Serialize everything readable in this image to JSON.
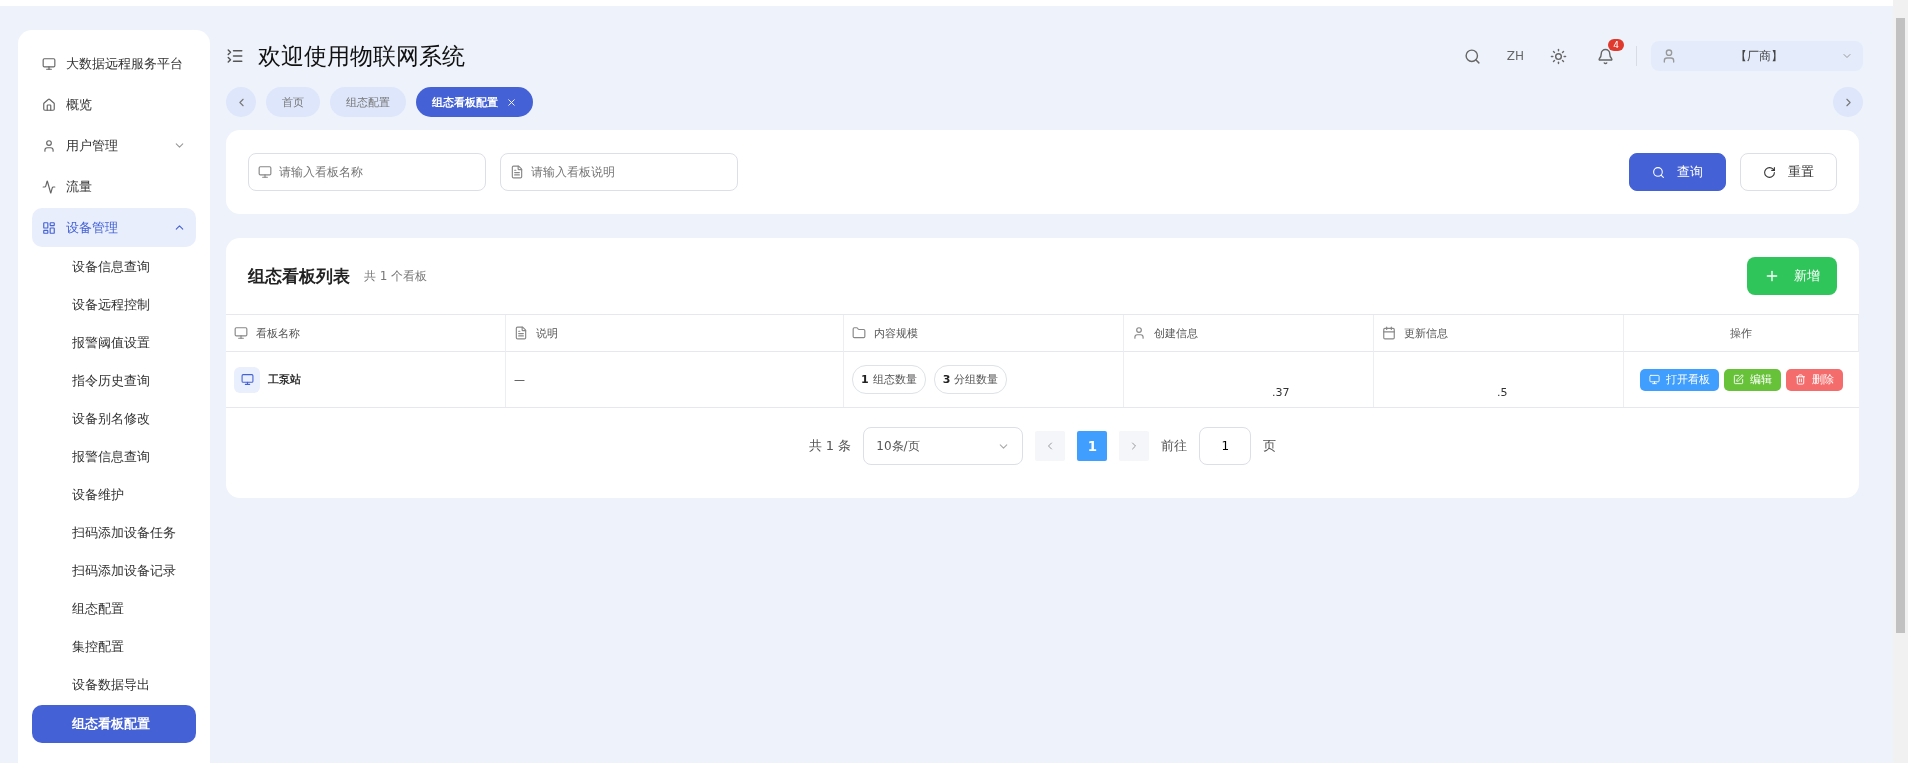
{
  "sidebar": {
    "items": [
      {
        "label": "大数据远程服务平台",
        "selected": false
      },
      {
        "label": "概览",
        "selected": false
      },
      {
        "label": "用户管理",
        "selected": false,
        "expanded": false
      },
      {
        "label": "流量",
        "selected": false
      },
      {
        "label": "设备管理",
        "selected": true,
        "expanded": true,
        "children": [
          {
            "label": "设备信息查询",
            "selected": false
          },
          {
            "label": "设备远程控制",
            "selected": false
          },
          {
            "label": "报警阈值设置",
            "selected": false
          },
          {
            "label": "指令历史查询",
            "selected": false
          },
          {
            "label": "设备别名修改",
            "selected": false
          },
          {
            "label": "报警信息查询",
            "selected": false
          },
          {
            "label": "设备维护",
            "selected": false
          },
          {
            "label": "扫码添加设备任务",
            "selected": false
          },
          {
            "label": "扫码添加设备记录",
            "selected": false
          },
          {
            "label": "组态配置",
            "selected": false
          },
          {
            "label": "集控配置",
            "selected": false
          },
          {
            "label": "设备数据导出",
            "selected": false
          },
          {
            "label": "组态看板配置",
            "selected": true
          }
        ]
      }
    ]
  },
  "header": {
    "title": "欢迎使用物联网系统",
    "language": "ZH",
    "notification_count": "4",
    "user": "【厂商】"
  },
  "tabs": [
    {
      "label": "首页",
      "selected": false
    },
    {
      "label": "组态配置",
      "selected": false
    },
    {
      "label": "组态看板配置",
      "selected": true
    }
  ],
  "search": {
    "fields": [
      {
        "placeholder": "请输入看板名称"
      },
      {
        "placeholder": "请输入看板说明"
      }
    ],
    "buttons": [
      {
        "label": "查询",
        "kind": "primary"
      },
      {
        "label": "重置",
        "kind": "default"
      }
    ]
  },
  "list": {
    "title": "组态看板列表",
    "count": "共 1 个看板",
    "add_button": "新增",
    "table": {
      "columns": [
        "看板名称",
        "说明",
        "内容规模",
        "创建信息",
        "更新信息",
        "操作"
      ],
      "rows": [
        {
          "name": "工泵站",
          "description": "—",
          "stats": [
            {
              "value": "1",
              "label": "组态数量"
            },
            {
              "value": "3",
              "label": "分组数量"
            }
          ],
          "created": ".37",
          "updated": ".5",
          "actions": [
            {
              "label": "打开看板",
              "kind": "open"
            },
            {
              "label": "编辑",
              "kind": "edit"
            },
            {
              "label": "删除",
              "kind": "delete"
            }
          ]
        }
      ]
    }
  },
  "pagination": {
    "total": "共 1 条",
    "page_size": "10条/页",
    "pages": [
      {
        "label": "1",
        "selected": true
      }
    ],
    "goto_label": "前往",
    "goto_value": "1",
    "goto_suffix": "页"
  }
}
